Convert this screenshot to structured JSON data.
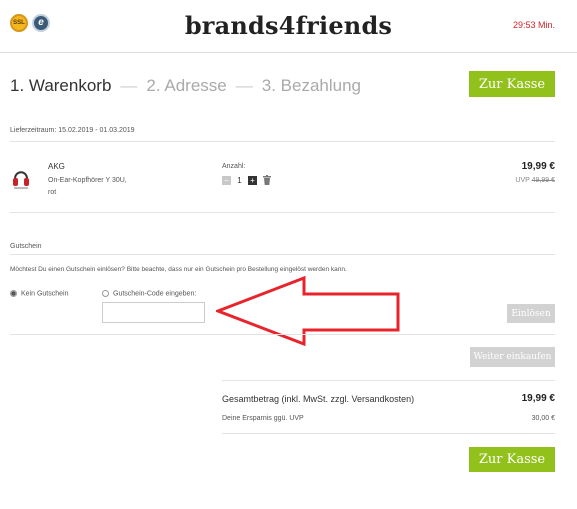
{
  "header": {
    "ssl_badge": "SSL",
    "trust_badge": "e",
    "logo": "brands4friends",
    "timer": "29:53 Min."
  },
  "steps": {
    "step1": "1. Warenkorb",
    "step2": "2. Adresse",
    "step3": "3. Bezahlung",
    "separator": "—"
  },
  "checkout_button_top": "Zur Kasse",
  "delivery": "Lieferzeitraum: 15.02.2019 - 01.03.2019",
  "item": {
    "brand": "AKG",
    "name": "On-Ear-Kopfhörer Y 30U,",
    "variant": "rot",
    "qty_label": "Anzahl:",
    "qty_minus": "−",
    "qty": "1",
    "qty_plus": "+",
    "price": "19,99 €",
    "uvp_label": "UVP",
    "uvp": "49,99 €",
    "colors": {
      "product": "#c9232a",
      "qty_minus_bg": "#c8c8c8",
      "qty_plus_bg": "#333333"
    }
  },
  "voucher": {
    "title": "Gutschein",
    "question": "Möchtest Du einen Gutschein einlösen? Bitte beachte, dass nur ein Gutschein pro Bestellung eingelöst werden kann.",
    "option_none": "Kein Gutschein",
    "option_code": "Gutschein-Code eingeben:",
    "input_value": "",
    "redeem_button": "Einlösen"
  },
  "continue_button": "Weiter einkaufen",
  "totals": {
    "total_label": "Gesamtbetrag (inkl. MwSt. zzgl. Versandkosten)",
    "total_value": "19,99 €",
    "savings_label": "Deine Ersparnis ggü. UVP",
    "savings_value": "30,00 €"
  },
  "checkout_button_bottom": "Zur Kasse",
  "annotation": {
    "arrow_color": "#e8232b",
    "arrow_icon": "red-arrow-left-icon"
  },
  "colors": {
    "accent": "#93c11c",
    "timer": "#d0242a",
    "disabled": "#d2d2d2"
  }
}
